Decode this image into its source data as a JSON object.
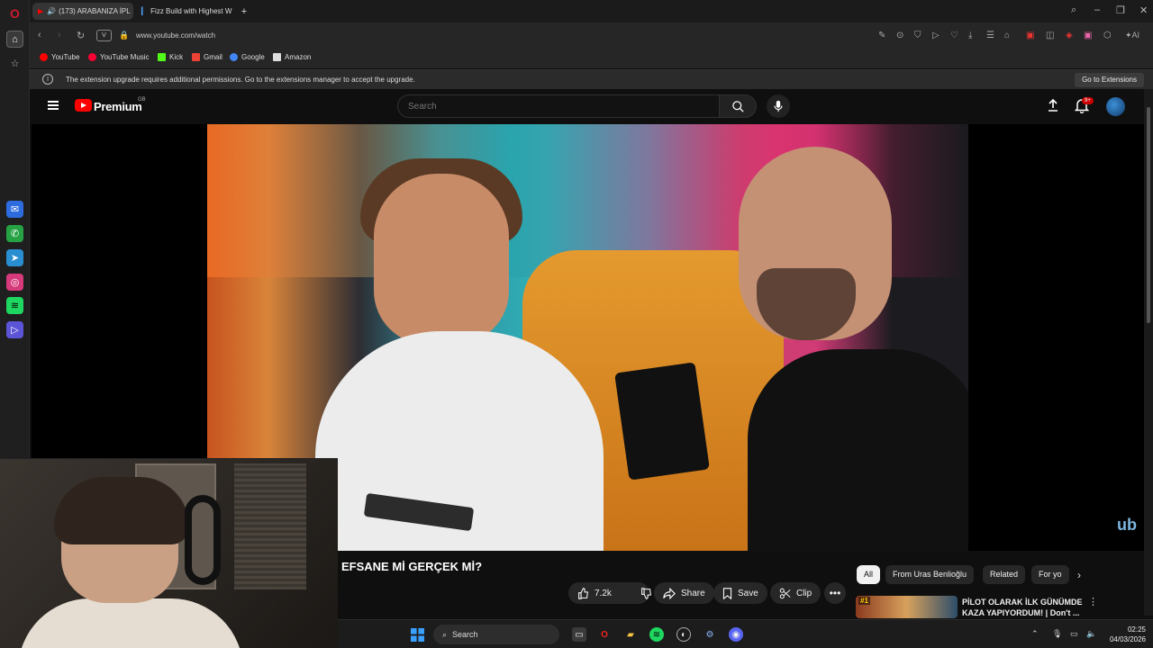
{
  "tabs": [
    {
      "label": "(173) ARABANIZA İPL",
      "active": true
    },
    {
      "label": "Fizz Build with Highest W",
      "active": false
    }
  ],
  "address": {
    "url": "www.youtube.com/watch",
    "badge": "V"
  },
  "bookmarks": [
    "YouTube",
    "YouTube Music",
    "Kick",
    "Gmail",
    "Google",
    "Amazon"
  ],
  "infobar": {
    "message": "The extension upgrade requires additional permissions. Go to the extensions manager to accept the upgrade.",
    "button": "Go to Extensions"
  },
  "toolbar_label": "AI",
  "youtube": {
    "brand": "Premium",
    "region": "GB",
    "search_placeholder": "Search",
    "notifications": "9+"
  },
  "video": {
    "title": "EFSANE Mİ GERÇEK Mİ?",
    "likes": "7.2k",
    "share": "Share",
    "save": "Save",
    "clip": "Clip",
    "watermark": "ub"
  },
  "chips": [
    "All",
    "From Uras Benlioğlu",
    "Related",
    "For yo"
  ],
  "related": {
    "rank": "#1",
    "title": "PİLOT OLARAK İLK GÜNÜMDE KAZA YAPIYORDUM! | Don't ..."
  },
  "taskbar": {
    "search": "Search",
    "time": "02:25",
    "date": "04/03/2026"
  },
  "colors": {
    "accent": "#ff0000",
    "opera": "#cc1a2e"
  }
}
